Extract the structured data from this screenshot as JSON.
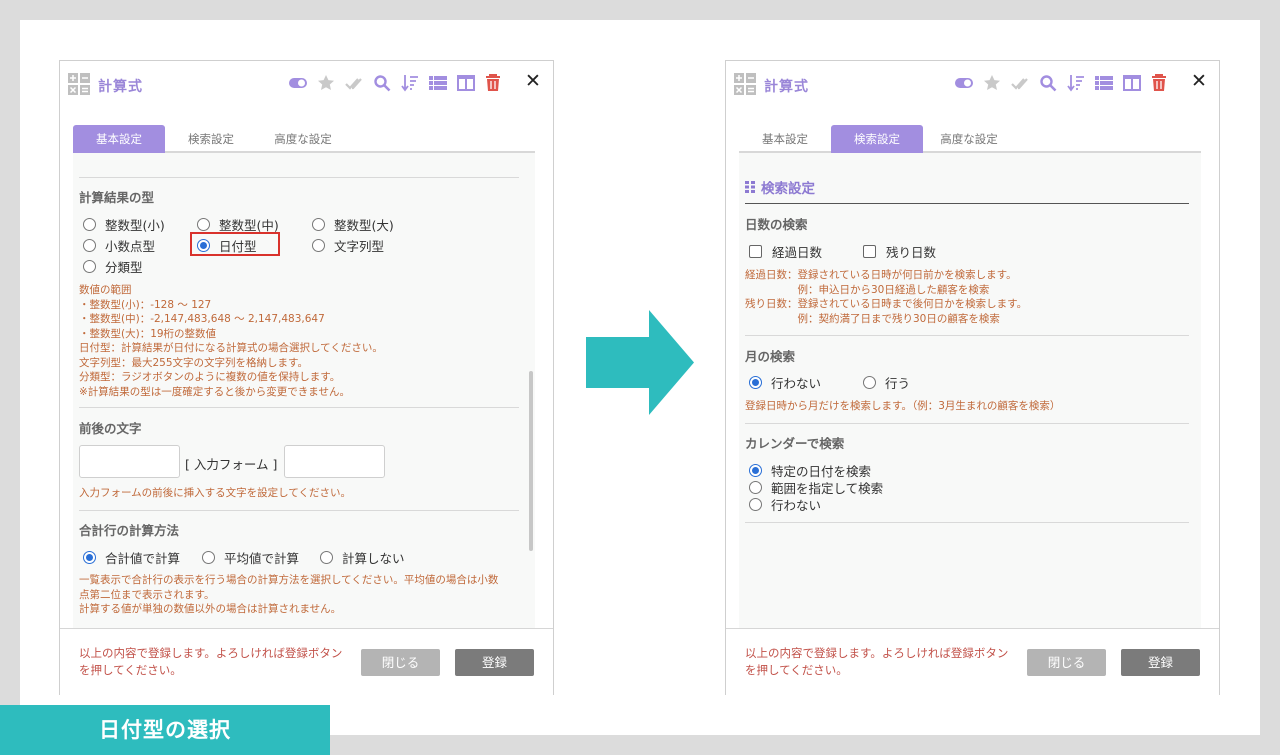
{
  "caption": "日付型の選択",
  "left_panel": {
    "title": "計算式",
    "tabs": [
      {
        "label": "基本設定",
        "active": true
      },
      {
        "label": "検索設定",
        "active": false
      },
      {
        "label": "高度な設定",
        "active": false
      }
    ],
    "result_type": {
      "title": "計算結果の型",
      "options": [
        {
          "label": "整数型(小)",
          "selected": false
        },
        {
          "label": "整数型(中)",
          "selected": false
        },
        {
          "label": "整数型(大)",
          "selected": false
        },
        {
          "label": "小数点型",
          "selected": false
        },
        {
          "label": "日付型",
          "selected": true,
          "highlighted": true
        },
        {
          "label": "文字列型",
          "selected": false
        },
        {
          "label": "分類型",
          "selected": false
        }
      ],
      "note": "数値の範囲\n・整数型(小)：-128 〜 127\n・整数型(中)：-2,147,483,648 〜 2,147,483,647\n・整数型(大)：19桁の整数値\n日付型：計算結果が日付になる計算式の場合選択してください。\n文字列型：最大255文字の文字列を格納します。\n分類型：ラジオボタンのように複数の値を保持します。\n※計算結果の型は一度確定すると後から変更できません。"
    },
    "affix": {
      "title": "前後の文字",
      "middle_label": "[ 入力フォーム ]",
      "prefix_value": "",
      "suffix_value": "",
      "note": "入力フォームの前後に挿入する文字を設定してください。"
    },
    "total_row": {
      "title": "合計行の計算方法",
      "options": [
        {
          "label": "合計値で計算",
          "selected": true
        },
        {
          "label": "平均値で計算",
          "selected": false
        },
        {
          "label": "計算しない",
          "selected": false
        }
      ],
      "note": "一覧表示で合計行の表示を行う場合の計算方法を選択してください。平均値の場合は小数\n点第二位まで表示されます。\n計算する値が単独の数値以外の場合は計算されません。"
    },
    "footer": {
      "message": "以上の内容で登録します。よろしければ登録ボタンを押してください。",
      "close_label": "閉じる",
      "register_label": "登録"
    }
  },
  "right_panel": {
    "title": "計算式",
    "tabs": [
      {
        "label": "基本設定",
        "active": false
      },
      {
        "label": "検索設定",
        "active": true
      },
      {
        "label": "高度な設定",
        "active": false
      }
    ],
    "section_title": "検索設定",
    "days_search": {
      "title": "日数の検索",
      "options": [
        {
          "label": "経過日数",
          "checked": false
        },
        {
          "label": "残り日数",
          "checked": false
        }
      ],
      "note": "経過日数：登録されている日時が何日前かを検索します。\n　　　　　例：申込日から30日経過した顧客を検索\n残り日数：登録されている日時まで後何日かを検索します。\n　　　　　例：契約満了日まで残り30日の顧客を検索"
    },
    "month_search": {
      "title": "月の検索",
      "options": [
        {
          "label": "行わない",
          "selected": true
        },
        {
          "label": "行う",
          "selected": false
        }
      ],
      "note": "登録日時から月だけを検索します。（例：3月生まれの顧客を検索）"
    },
    "calendar_search": {
      "title": "カレンダーで検索",
      "options": [
        {
          "label": "特定の日付を検索",
          "selected": true
        },
        {
          "label": "範囲を指定して検索",
          "selected": false
        },
        {
          "label": "行わない",
          "selected": false
        }
      ]
    },
    "footer": {
      "message": "以上の内容で登録します。よろしければ登録ボタンを押してください。",
      "close_label": "閉じる",
      "register_label": "登録"
    }
  },
  "colors": {
    "accent": "#a28ee0",
    "note": "#c0693a",
    "highlight": "#d9322c",
    "arrow": "#2ebcbe",
    "delete": "#e0544b"
  },
  "toolbar_icons": [
    "toggle-icon",
    "star-icon",
    "double-check-icon",
    "search-icon",
    "sort-icon",
    "list-icon",
    "columns-icon",
    "trash-icon"
  ]
}
